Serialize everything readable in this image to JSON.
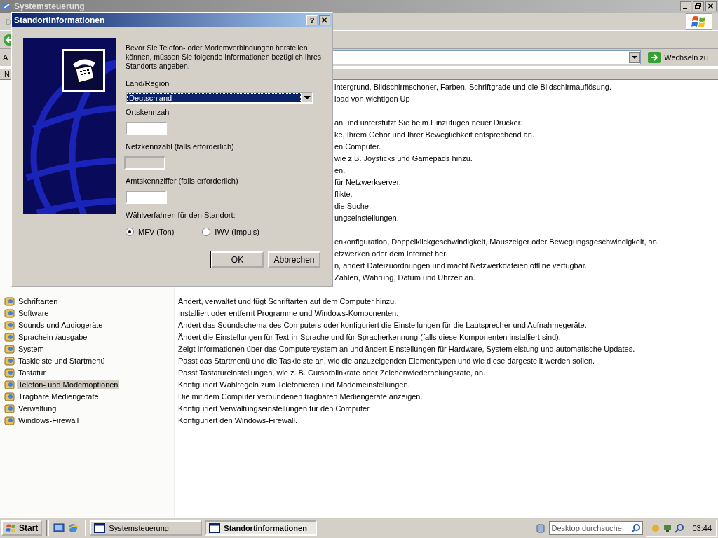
{
  "window": {
    "title": "Systemsteuerung"
  },
  "menu_bar": {
    "items": [
      "D"
    ]
  },
  "address_bar": {
    "label": "A",
    "go_button": "Wechseln zu"
  },
  "list": {
    "columns": [
      "N"
    ],
    "rows": [
      {
        "kind": "partial",
        "description": "intergrund, Bildschirmschoner, Farben, Schriftgrade und die Bildschirmauflösung."
      },
      {
        "kind": "partial",
        "description": "load von wichtigen Up"
      },
      {
        "kind": "hidden"
      },
      {
        "kind": "partial",
        "description": "an und unterstützt Sie beim Hinzufügen neuer Drucker."
      },
      {
        "kind": "partial",
        "description": "ke, Ihrem Gehör und Ihrer Beweglichkeit entsprechend an."
      },
      {
        "kind": "partial",
        "description": "en Computer."
      },
      {
        "kind": "partial",
        "description": "wie z.B. Joysticks und Gamepads hinzu."
      },
      {
        "kind": "partial",
        "description": "en."
      },
      {
        "kind": "partial",
        "description": "für Netzwerkserver."
      },
      {
        "kind": "partial",
        "description": "flikte."
      },
      {
        "kind": "partial",
        "description": "die Suche."
      },
      {
        "kind": "partial",
        "description": "ungseinstellungen."
      },
      {
        "kind": "hidden"
      },
      {
        "kind": "partial",
        "description": "enkonfiguration, Doppelklickgeschwindigkeit, Mauszeiger oder Bewegungsgeschwindigkeit, an."
      },
      {
        "kind": "partial",
        "description": "etzwerken oder dem Internet her."
      },
      {
        "kind": "partial",
        "description": "n, ändert Dateizuordnungen und macht Netzwerkdateien offline verfügbar."
      },
      {
        "kind": "partial",
        "description": "Zahlen, Währung, Datum und Uhrzeit an."
      },
      {
        "kind": "hidden"
      },
      {
        "kind": "full",
        "name": "Schriftarten",
        "description": "Ändert, verwaltet und fügt Schriftarten auf dem Computer hinzu.",
        "selected": false
      },
      {
        "kind": "full",
        "name": "Software",
        "description": "Installiert oder entfernt Programme und Windows-Komponenten.",
        "selected": false
      },
      {
        "kind": "full",
        "name": "Sounds und Audiogeräte",
        "description": "Ändert das Soundschema des Computers oder konfiguriert die Einstellungen für die Lautsprecher und Aufnahmegeräte.",
        "selected": false
      },
      {
        "kind": "full",
        "name": "Sprachein-/ausgabe",
        "description": "Ändert die Einstellungen für Text-in-Sprache und für Spracherkennung (falls diese Komponenten installiert sind).",
        "selected": false
      },
      {
        "kind": "full",
        "name": "System",
        "description": "Zeigt Informationen über das Computersystem an und ändert Einstellungen für Hardware, Systemleistung und automatische Updates.",
        "selected": false
      },
      {
        "kind": "full",
        "name": "Taskleiste und Startmenü",
        "description": "Passt das Startmenü und die Taskleiste an, wie die anzuzeigenden Elementtypen und wie diese dargestellt werden sollen.",
        "selected": false
      },
      {
        "kind": "full",
        "name": "Tastatur",
        "description": "Passt Tastatureinstellungen, wie z. B. Cursorblinkrate oder Zeichenwiederholungsrate, an.",
        "selected": false
      },
      {
        "kind": "full",
        "name": "Telefon- und Modemoptionen",
        "description": "Konfiguriert Wählregeln zum Telefonieren und Modemeinstellungen.",
        "selected": true
      },
      {
        "kind": "full",
        "name": "Tragbare Mediengeräte",
        "description": "Die mit dem Computer verbundenen tragbaren Mediengeräte anzeigen.",
        "selected": false
      },
      {
        "kind": "full",
        "name": "Verwaltung",
        "description": "Konfiguriert Verwaltungseinstellungen für den Computer.",
        "selected": false
      },
      {
        "kind": "full",
        "name": "Windows-Firewall",
        "description": "Konfiguriert den Windows-Firewall.",
        "selected": false
      }
    ]
  },
  "dialog": {
    "title": "Standortinformationen",
    "help_button": "?",
    "intro": "Bevor Sie Telefon- oder Modemverbindungen herstellen können, müssen Sie folgende Informationen bezüglich Ihres Standorts angeben.",
    "fields": [
      {
        "kind": "dropdown",
        "label": "Land/Region",
        "value": "Deutschland"
      },
      {
        "kind": "text",
        "label": "Ortskennzahl",
        "disabled": false
      },
      {
        "kind": "text",
        "label": "Netzkennzahl (falls erforderlich)",
        "disabled": true
      },
      {
        "kind": "text",
        "label": "Amtskennziffer (falls erforderlich)",
        "disabled": false
      }
    ],
    "dial_label": "Wählverfahren für den Standort:",
    "dial_options": [
      {
        "label": "MFV (Ton)",
        "selected": true
      },
      {
        "label": "IWV (Impuls)",
        "selected": false
      }
    ],
    "buttons": [
      {
        "label": "OK",
        "default": true
      },
      {
        "label": "Abbrechen",
        "default": false
      }
    ]
  },
  "taskbar": {
    "start": "Start",
    "tasks": [
      {
        "label": "Systemsteuerung",
        "selected": false
      },
      {
        "label": "Standortinformationen",
        "selected": true
      }
    ],
    "search": {
      "value": "Desktop durchsuche"
    },
    "clock": "03:44"
  }
}
